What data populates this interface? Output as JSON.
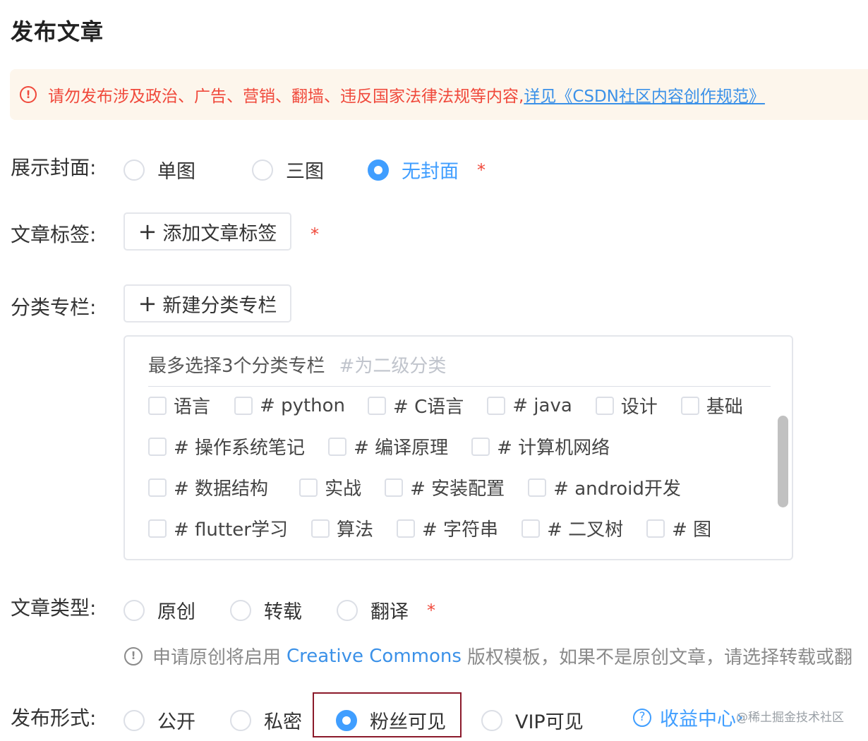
{
  "page": {
    "title": "发布文章"
  },
  "notice": {
    "text": "请勿发布涉及政治、广告、营销、翻墙、违反国家法律法规等内容,",
    "link": "详见《CSDN社区内容创作规范》"
  },
  "cover": {
    "label": "展示封面:",
    "options": [
      "单图",
      "三图",
      "无封面"
    ],
    "selected": "无封面",
    "required": "*"
  },
  "tags": {
    "label": "文章标签:",
    "add_button": "添加文章标签",
    "required": "*"
  },
  "category": {
    "label": "分类专栏:",
    "add_button": "新建分类专栏",
    "hint": "最多选择3个分类专栏",
    "hint_sub": "#为二级分类",
    "rows": [
      [
        "语言",
        "# python",
        "# C语言",
        "# java",
        "设计",
        "基础"
      ],
      [
        "# 操作系统笔记",
        "# 编译原理",
        "# 计算机网络"
      ],
      [
        "# 数据结构",
        "实战",
        "# 安装配置",
        "# android开发"
      ],
      [
        "# flutter学习",
        "算法",
        "# 字符串",
        "# 二叉树",
        "# 图"
      ]
    ]
  },
  "article_type": {
    "label": "文章类型:",
    "options": [
      "原创",
      "转载",
      "翻译"
    ],
    "required": "*",
    "info_prefix": "申请原创将启用",
    "info_link": "Creative Commons",
    "info_suffix": "版权模板，如果不是原创文章，请选择转载或翻"
  },
  "publish": {
    "label": "发布形式:",
    "options": [
      "公开",
      "私密",
      "粉丝可见",
      "VIP可见"
    ],
    "selected": "粉丝可见",
    "income_link": "收益中心",
    "income_arrow": "›"
  },
  "watermark": "@稀土掘金技术社区",
  "colors": {
    "primary": "#409eff",
    "danger": "#f0493b",
    "notice_bg": "#fdf6ec",
    "highlight": "#8b1a2b"
  }
}
